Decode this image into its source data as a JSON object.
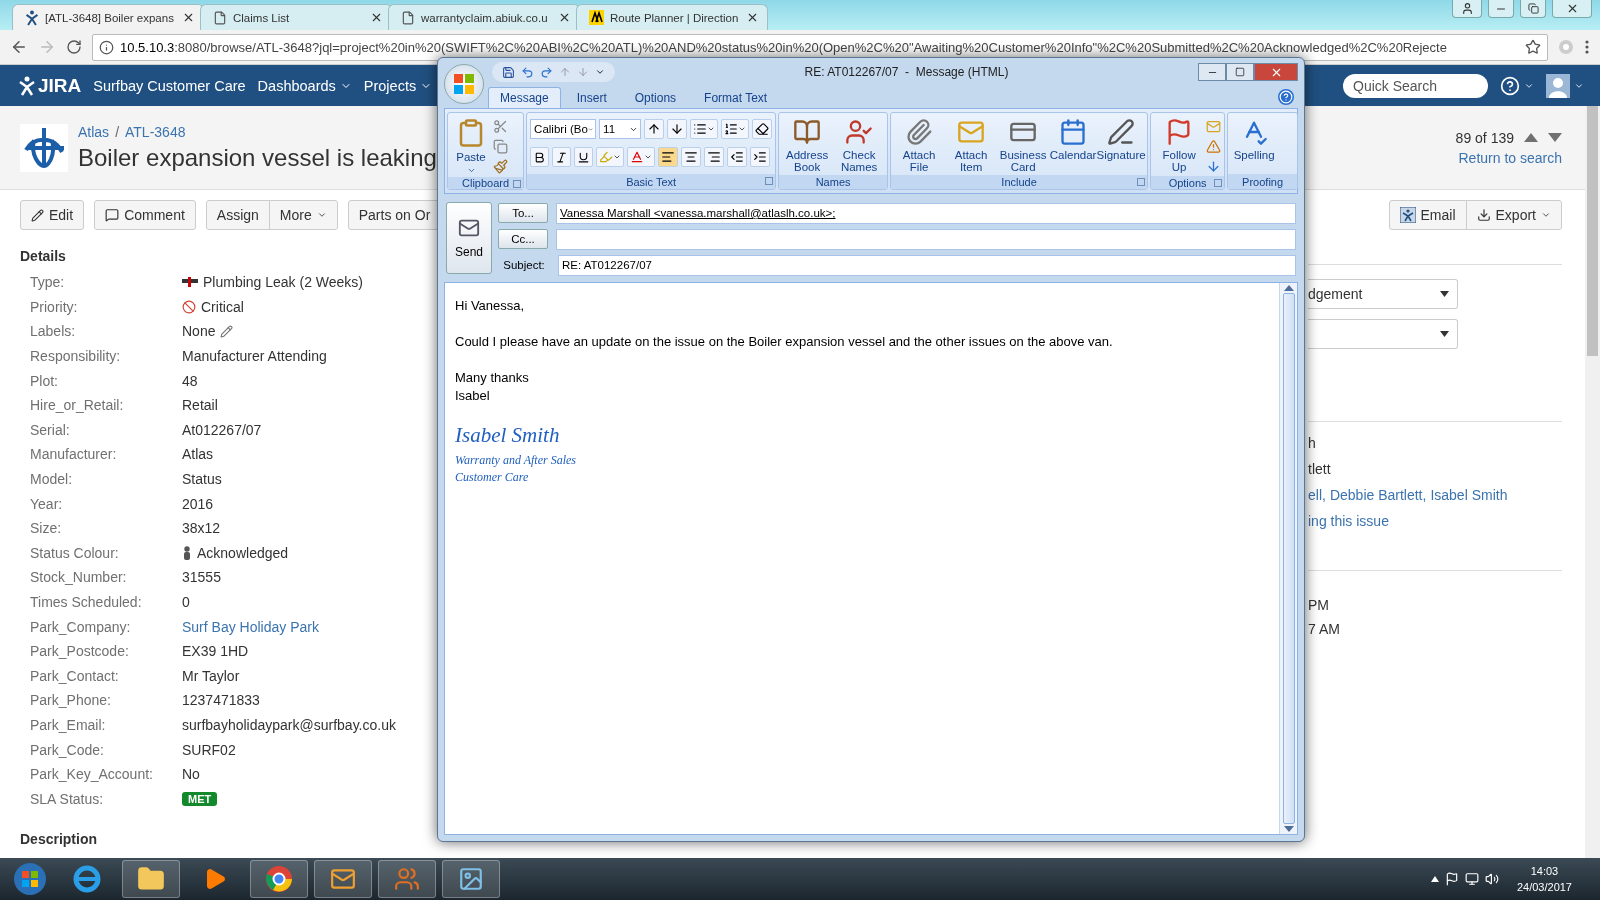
{
  "browser": {
    "tabs": [
      {
        "title": "[ATL-3648] Boiler expans",
        "selected": true,
        "kind": "jira"
      },
      {
        "title": "Claims List",
        "selected": false,
        "kind": "page"
      },
      {
        "title": "warrantyclaim.abiuk.co.u",
        "selected": false,
        "kind": "page"
      },
      {
        "title": "Route Planner | Direction",
        "selected": false,
        "kind": "aa"
      }
    ],
    "url_host": "10.5.10.3",
    "url_rest": ":8080/browse/ATL-3648?jql=project%20in%20(SWIFT%2C%20ABI%2C%20ATL)%20AND%20status%20in%20(Open%2C%20\"Awaiting%20Customer%20Info\"%2C%20Submitted%2C%20Acknowledged%2C%20Rejecte"
  },
  "jira": {
    "logo": "JIRA",
    "site": "Surfbay Customer Care",
    "menus": [
      "Dashboards",
      "Projects"
    ],
    "search": {
      "placeholder": "Quick Search"
    }
  },
  "issue": {
    "project": "Atlas",
    "separator": "/",
    "key": "ATL-3648",
    "title": "Boiler expansion vessel is leaking",
    "pager": "89 of 139",
    "return": "Return to search",
    "actions": [
      {
        "label": "Edit",
        "kind": "edit"
      },
      {
        "label": "Comment",
        "kind": "comment"
      },
      {
        "label": "Assign",
        "kind": "group-start"
      },
      {
        "label": "More",
        "kind": "group-menu"
      },
      {
        "label": "Parts on Or",
        "kind": "plain"
      }
    ],
    "right_actions": [
      {
        "label": "Email",
        "kind": "email"
      },
      {
        "label": "Export",
        "kind": "export"
      }
    ],
    "details_heading": "Details",
    "fields": [
      {
        "label": "Type:",
        "value": "Plumbing Leak (2 Weeks)",
        "kind": "type"
      },
      {
        "label": "Priority:",
        "value": "Critical",
        "kind": "priority"
      },
      {
        "label": "Labels:",
        "value": "None",
        "kind": "labels"
      },
      {
        "label": "Responsibility:",
        "value": "Manufacturer Attending",
        "kind": "text"
      },
      {
        "label": "Plot:",
        "value": "48",
        "kind": "text"
      },
      {
        "label": "Hire_or_Retail:",
        "value": "Retail",
        "kind": "text"
      },
      {
        "label": "Serial:",
        "value": "At012267/07",
        "kind": "text"
      },
      {
        "label": "Manufacturer:",
        "value": "Atlas",
        "kind": "text"
      },
      {
        "label": "Model:",
        "value": "Status",
        "kind": "text"
      },
      {
        "label": "Year:",
        "value": "2016",
        "kind": "text"
      },
      {
        "label": "Size:",
        "value": "38x12",
        "kind": "text"
      },
      {
        "label": "Status Colour:",
        "value": "Acknowledged",
        "kind": "status"
      },
      {
        "label": "Stock_Number:",
        "value": "31555",
        "kind": "text"
      },
      {
        "label": "Times Scheduled:",
        "value": "0",
        "kind": "text"
      },
      {
        "label": "Park_Company:",
        "value": "Surf Bay Holiday Park",
        "kind": "link"
      },
      {
        "label": "Park_Postcode:",
        "value": "EX39 1HD",
        "kind": "text"
      },
      {
        "label": "Park_Contact:",
        "value": "Mr Taylor",
        "kind": "text"
      },
      {
        "label": "Park_Phone:",
        "value": "1237471833",
        "kind": "text"
      },
      {
        "label": "Park_Email:",
        "value": "surfbayholidaypark@surfbay.co.uk",
        "kind": "text"
      },
      {
        "label": "Park_Code:",
        "value": "SURF02",
        "kind": "text"
      },
      {
        "label": "Park_Key_Account:",
        "value": "No",
        "kind": "text"
      },
      {
        "label": "SLA Status:",
        "value": "MET",
        "kind": "badge"
      }
    ],
    "description_heading": "Description",
    "selects": [
      {
        "kind": "value",
        "value": "dgement"
      },
      {
        "kind": "empty"
      }
    ],
    "people": [
      {
        "kind": "text",
        "text": "h"
      },
      {
        "kind": "text",
        "text": "tlett"
      },
      {
        "kind": "links",
        "links": [
          "ell,",
          "Debbie Bartlett,",
          "Isabel Smith"
        ]
      },
      {
        "kind": "link",
        "text": "ing this issue"
      }
    ],
    "dates": [
      "PM",
      "7 AM"
    ]
  },
  "message": {
    "title": "RE: AT012267/07  -  Message (HTML)",
    "tabs": [
      {
        "label": "Message",
        "selected": true
      },
      {
        "label": "Insert",
        "selected": false
      },
      {
        "label": "Options",
        "selected": false
      },
      {
        "label": "Format Text",
        "selected": false
      }
    ],
    "groups": [
      {
        "label": "Clipboard",
        "kind": "clipboard",
        "buttons": [
          "Paste"
        ]
      },
      {
        "label": "Basic Text",
        "kind": "basic",
        "font": "Calibri (Bo",
        "size": "11"
      },
      {
        "label": "Names",
        "kind": "big",
        "buttons": [
          "Address Book",
          "Check Names"
        ]
      },
      {
        "label": "Include",
        "kind": "big",
        "buttons": [
          "Attach File",
          "Attach Item",
          "Business Card",
          "Calendar",
          "Signature"
        ]
      },
      {
        "label": "Options",
        "kind": "options",
        "buttons": [
          "Follow Up"
        ]
      },
      {
        "label": "Proofing",
        "kind": "big",
        "buttons": [
          "Spelling"
        ]
      }
    ],
    "send": "Send",
    "to_button": "To...",
    "cc_button": "Cc...",
    "subject_label": "Subject:",
    "to": "Vanessa Marshall <vanessa.marshall@atlaslh.co.uk>;",
    "subject": "RE: AT012267/07",
    "body": [
      "Hi Vanessa,",
      "Could I please have an update on the issue on the Boiler expansion vessel and the other issues on the above van.",
      "Many thanks\nIsabel"
    ],
    "signature": {
      "name": "Isabel Smith",
      "lines": [
        "Warranty and After Sales",
        "Customer Care"
      ]
    }
  },
  "taskbar": {
    "time": "14:03",
    "date": "24/03/2017"
  }
}
